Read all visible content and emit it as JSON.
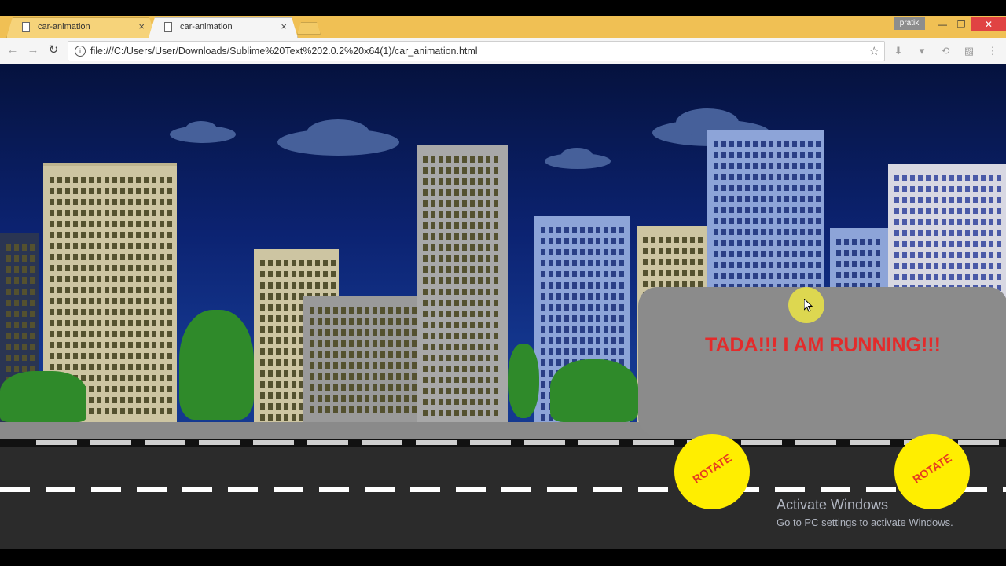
{
  "browser": {
    "tabs": [
      {
        "label": "car-animation",
        "close": "×"
      },
      {
        "label": "car-animation",
        "close": "×"
      }
    ],
    "user_badge": "pratik",
    "window_controls": {
      "minimize": "—",
      "restore": "❐",
      "close": "✕"
    },
    "nav": {
      "back": "←",
      "forward": "→",
      "reload": "↻"
    },
    "address": {
      "info_icon": "i",
      "url": "file:///C:/Users/User/Downloads/Sublime%20Text%202.0.2%20x64(1)/car_animation.html",
      "star": "☆"
    },
    "extensions": [
      "⬇",
      "▾",
      "⟲",
      "▨",
      "⋮"
    ]
  },
  "page": {
    "banner_text": "TADA!!! I AM  RUNNING!!!",
    "wheels": [
      {
        "label": "ROTATE"
      },
      {
        "label": "ROTATE"
      }
    ],
    "colors": {
      "sky_top": "#05123e",
      "sky_bottom": "#163d92",
      "banner_text": "#e32b2b",
      "wheel": "#ffee00",
      "road": "#2b2b2b"
    }
  },
  "overlay": {
    "activate_title": "Activate Windows",
    "activate_subtitle": "Go to PC settings to activate Windows."
  }
}
